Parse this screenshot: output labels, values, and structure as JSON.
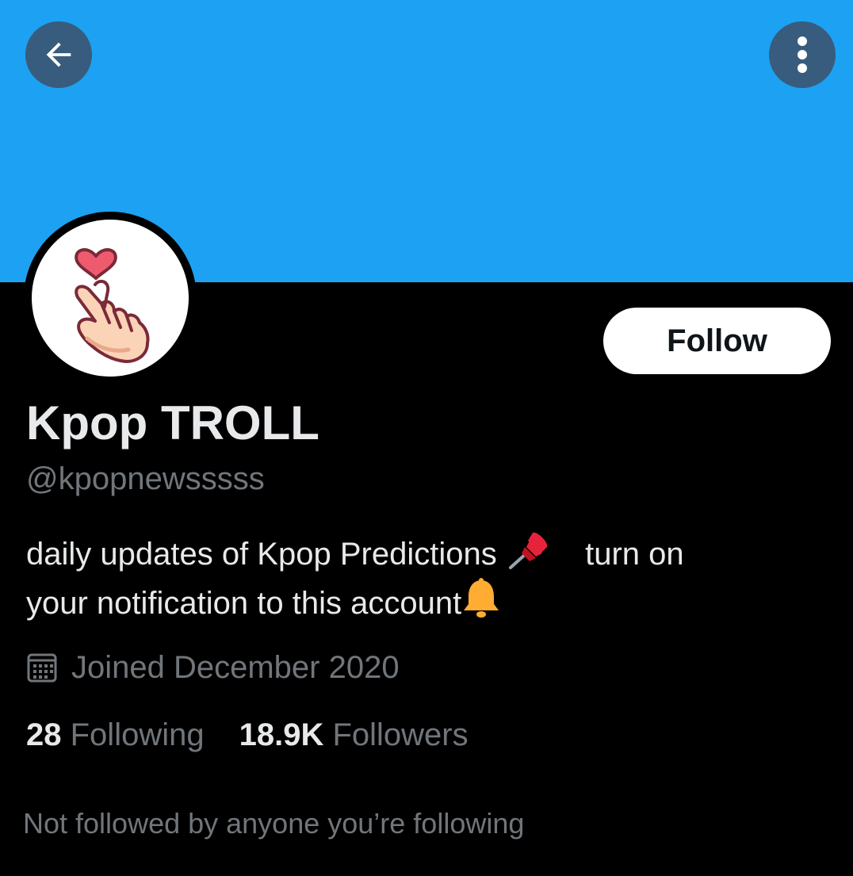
{
  "header": {
    "back_icon": "arrow-left-icon",
    "more_icon": "more-vertical-icon",
    "banner_color": "#1DA1F2"
  },
  "profile": {
    "avatar_icon": "finger-heart-icon",
    "display_name": "Kpop TROLL",
    "handle": "@kpopnewsssss",
    "bio": {
      "line1_a": "daily updates of Kpop Predictions",
      "line1_b": "turn on",
      "line2": "your notification to this account",
      "emoji_1": "pushpin-icon",
      "emoji_2": "bell-icon"
    },
    "joined_icon": "calendar-icon",
    "joined": "Joined December 2020",
    "following_count": "28",
    "following_label": "Following",
    "followers_count": "18.9K",
    "followers_label": "Followers",
    "not_followed_text": "Not followed by anyone you’re following"
  },
  "actions": {
    "follow_label": "Follow"
  },
  "colors": {
    "background": "#000000",
    "primary_text": "#e7e9ea",
    "secondary_text": "#71767b",
    "button_bg": "#ffffff"
  }
}
